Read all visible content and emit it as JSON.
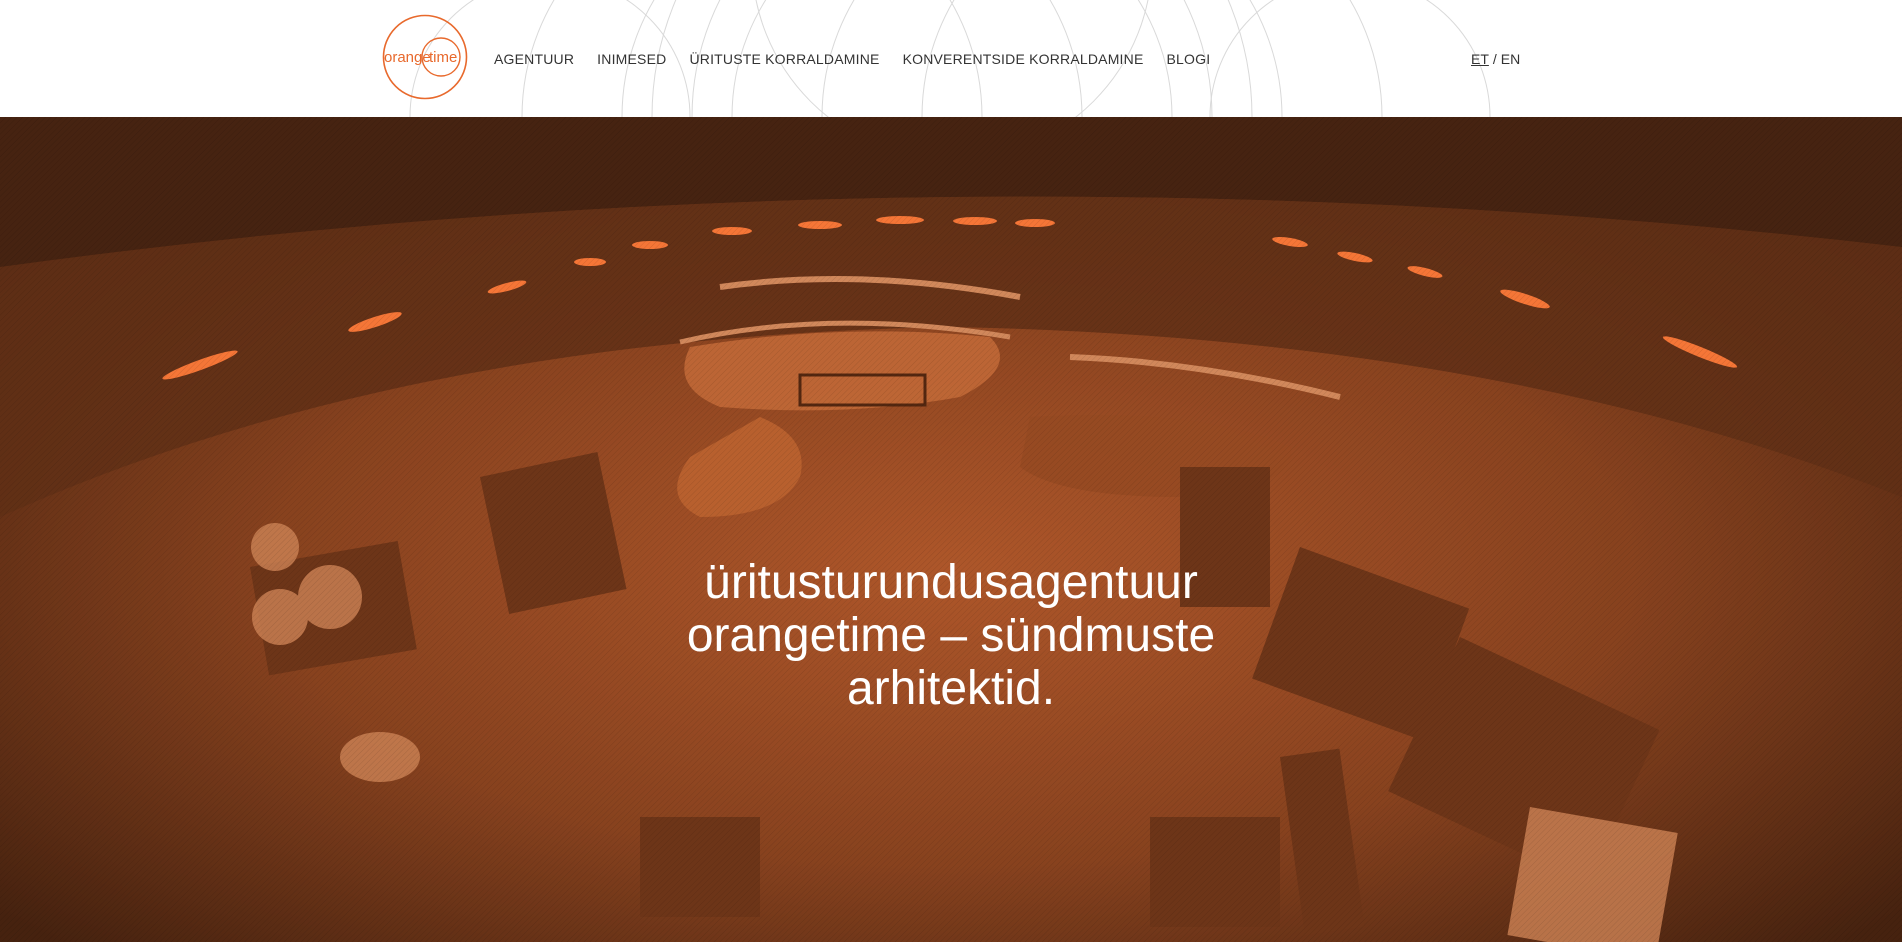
{
  "brand": {
    "logo_text_left": "orange",
    "logo_text_right": "time",
    "accent_color": "#e8692c"
  },
  "nav": {
    "items": [
      {
        "label": "AGENTUUR"
      },
      {
        "label": "INIMESED"
      },
      {
        "label": "ÜRITUSTE KORRALDAMINE"
      },
      {
        "label": "KONVERENTSIDE KORRALDAMINE"
      },
      {
        "label": "BLOGI"
      }
    ]
  },
  "language": {
    "current": "ET",
    "separator": "/",
    "other": "EN"
  },
  "hero": {
    "title_lines": [
      "üritusturundusagentuur",
      "orangetime – sündmuste",
      "arhitektid."
    ],
    "overlay_color": "#c5622c"
  }
}
